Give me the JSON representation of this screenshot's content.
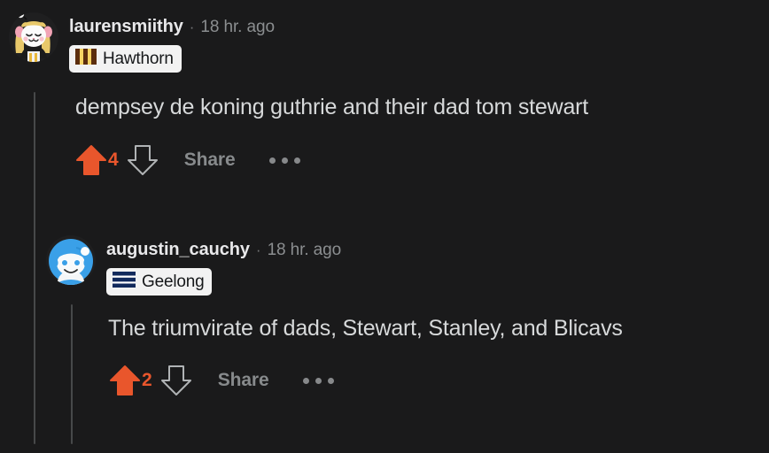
{
  "theme": {
    "background": "#1a1a1b",
    "upvote_orange": "#e9562c",
    "username_color": "#e8e8ea",
    "timestamp_color": "#8b8e90",
    "body_color": "#d7d9da",
    "muted_color": "#878a8c",
    "thread_line_color": "#47494a",
    "flair_background": "#f2f2f2"
  },
  "comments": [
    {
      "username": "laurensmiithy",
      "separator": "·",
      "timestamp": "18 hr. ago",
      "avatar_name": "avatar-bee-cat",
      "flair": {
        "label": "Hawthorn",
        "icon_name": "hawthorn-stripes-icon",
        "icon_orientation": "vertical",
        "colors": [
          "#5c2e0e",
          "#f5d463",
          "#5c2e0e",
          "#f5d463",
          "#5c2e0e"
        ]
      },
      "body": "dempsey de koning guthrie and their dad tom stewart",
      "score": "4",
      "upvote_state": "active",
      "downvote_state": "inactive",
      "share_label": "Share",
      "more_label": "more-options"
    },
    {
      "username": "augustin_cauchy",
      "separator": "·",
      "timestamp": "18 hr. ago",
      "avatar_name": "avatar-snoo-blue",
      "flair": {
        "label": "Geelong",
        "icon_name": "geelong-stripes-icon",
        "icon_orientation": "horizontal",
        "colors": [
          "#122a5c",
          "#ffffff",
          "#122a5c",
          "#ffffff",
          "#122a5c"
        ]
      },
      "body": "The triumvirate of dads, Stewart, Stanley, and Blicavs",
      "score": "2",
      "upvote_state": "active",
      "downvote_state": "inactive",
      "share_label": "Share",
      "more_label": "more-options"
    }
  ]
}
